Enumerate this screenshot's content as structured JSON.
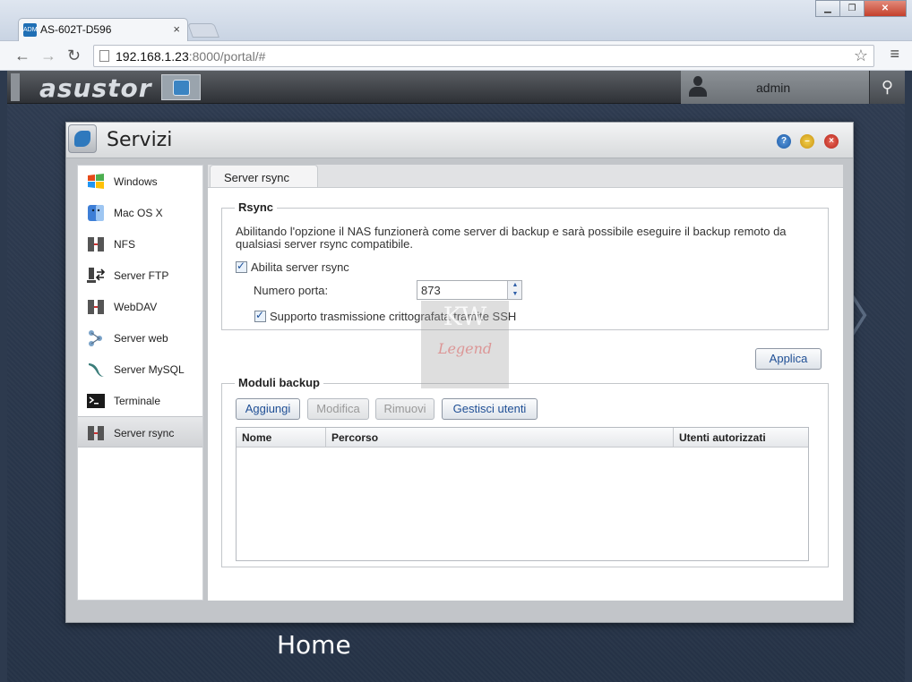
{
  "browser": {
    "tab_title": "AS-602T-D596",
    "tab_favicon": "ADM",
    "url_host": "192.168.1.23",
    "url_rest": ":8000/portal/#"
  },
  "asustor": {
    "logo": "asustor",
    "user": "admin"
  },
  "window": {
    "title": "Servizi",
    "help_icon": "?",
    "min_icon": "–",
    "close_icon": "×"
  },
  "sidebar": {
    "items": [
      {
        "label": "Windows",
        "icon": "windows-icon"
      },
      {
        "label": "Mac OS X",
        "icon": "finder-icon"
      },
      {
        "label": "NFS",
        "icon": "server-icon"
      },
      {
        "label": "Server FTP",
        "icon": "ftp-icon"
      },
      {
        "label": "WebDAV",
        "icon": "server-icon"
      },
      {
        "label": "Server web",
        "icon": "network-icon"
      },
      {
        "label": "Server MySQL",
        "icon": "dolphin-icon"
      },
      {
        "label": "Terminale",
        "icon": "terminal-icon"
      },
      {
        "label": "Server rsync",
        "icon": "server-icon",
        "selected": true
      }
    ]
  },
  "panel": {
    "tab": "Server rsync",
    "rsync": {
      "legend": "Rsync",
      "description": "Abilitando l'opzione il NAS funzionerà come server di backup e sarà possibile eseguire il backup remoto da qualsiasi server rsync compatibile.",
      "enable_label": "Abilita server rsync",
      "enable_checked": true,
      "port_label": "Numero porta:",
      "port_value": "873",
      "ssh_label": "Supporto trasmissione crittografata tramite SSH",
      "ssh_checked": true
    },
    "apply_label": "Applica",
    "modules": {
      "legend": "Moduli backup",
      "buttons": {
        "add": "Aggiungi",
        "edit": "Modifica",
        "remove": "Rimuovi",
        "manage_users": "Gestisci utenti"
      },
      "columns": [
        "Nome",
        "Percorso",
        "Utenti autorizzati"
      ],
      "rows": []
    }
  },
  "watermark": {
    "line1": "KW",
    "line2": "Legend"
  },
  "desktop": {
    "home_label": "Home"
  }
}
